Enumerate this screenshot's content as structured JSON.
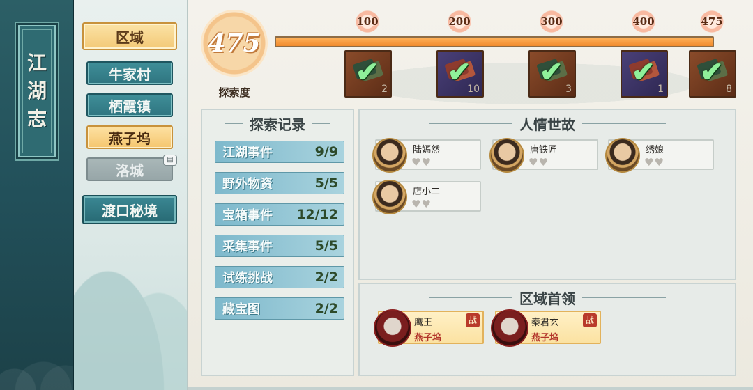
{
  "title": [
    "江",
    "湖",
    "志"
  ],
  "region": {
    "header": "区域",
    "items": [
      {
        "label": "牛家村",
        "state": "normal"
      },
      {
        "label": "栖霞镇",
        "state": "normal"
      },
      {
        "label": "燕子坞",
        "state": "active"
      },
      {
        "label": "洛城",
        "state": "locked"
      }
    ],
    "special": "渡口秘境"
  },
  "exploration": {
    "score": "475",
    "label": "探索度",
    "progress_fraction": 1.0,
    "milestones": [
      {
        "value": "100",
        "reward_count": "2",
        "color": "brown",
        "claimed": true
      },
      {
        "value": "200",
        "reward_count": "10",
        "color": "purple",
        "claimed": true
      },
      {
        "value": "300",
        "reward_count": "3",
        "color": "brown",
        "claimed": true
      },
      {
        "value": "400",
        "reward_count": "1",
        "color": "purple",
        "claimed": true
      },
      {
        "value": "475",
        "reward_count": "8",
        "color": "brown",
        "claimed": true
      }
    ]
  },
  "records": {
    "title": "探索记录",
    "rows": [
      {
        "label": "江湖事件",
        "value": "9/9"
      },
      {
        "label": "野外物资",
        "value": "5/5"
      },
      {
        "label": "宝箱事件",
        "value": "12/12"
      },
      {
        "label": "采集事件",
        "value": "5/5"
      },
      {
        "label": "试练挑战",
        "value": "2/2"
      },
      {
        "label": "藏宝图",
        "value": "2/2"
      }
    ]
  },
  "relations": {
    "title": "人情世故",
    "npcs": [
      {
        "name": "陆嫣然",
        "hearts": "♥♥"
      },
      {
        "name": "唐铁匠",
        "hearts": "♥♥"
      },
      {
        "name": "绣娘",
        "hearts": "♥♥"
      },
      {
        "name": "店小二",
        "hearts": "♥♥"
      }
    ]
  },
  "bosses": {
    "title": "区域首领",
    "fight_label": "战",
    "items": [
      {
        "name": "鹰王",
        "location": "燕子坞"
      },
      {
        "name": "秦君玄",
        "location": "燕子坞"
      }
    ]
  }
}
